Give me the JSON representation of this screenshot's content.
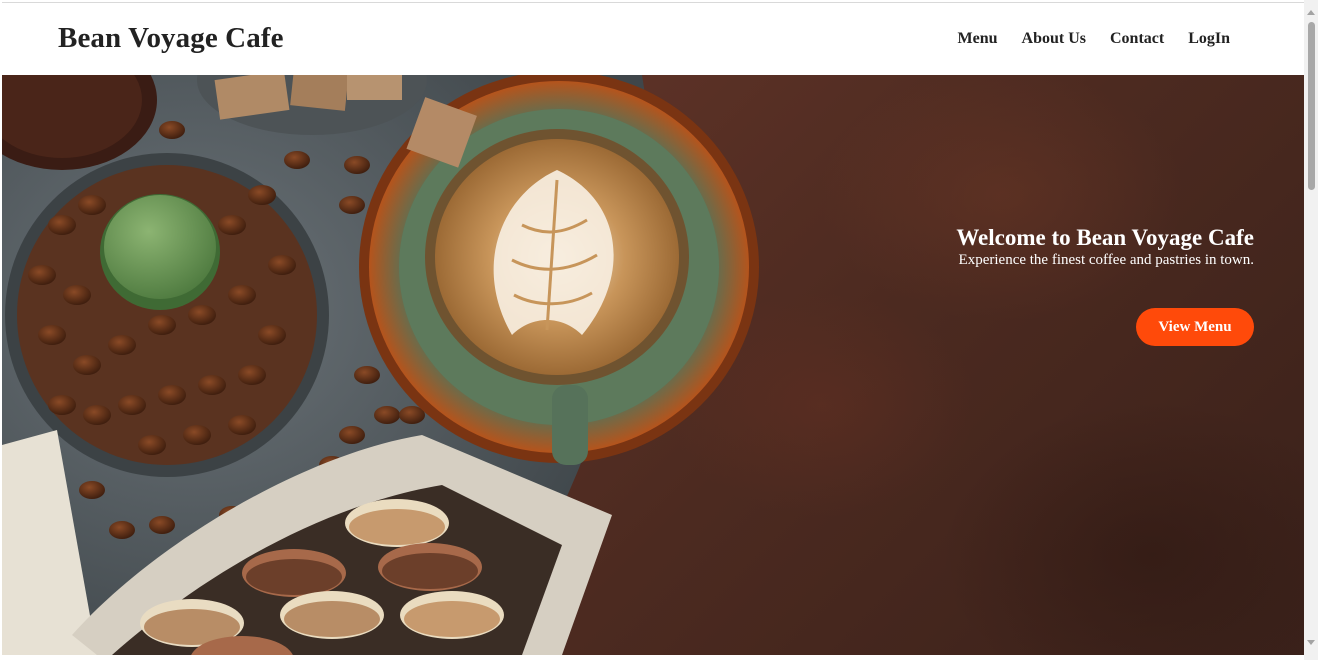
{
  "header": {
    "brand": "Bean Voyage Cafe",
    "nav": [
      {
        "label": "Menu"
      },
      {
        "label": "About Us"
      },
      {
        "label": "Contact"
      },
      {
        "label": "LogIn"
      }
    ]
  },
  "hero": {
    "title": "Welcome to Bean Voyage Cafe",
    "subtitle": "Experience the finest coffee and pastries in town.",
    "cta_label": "View Menu"
  },
  "colors": {
    "accent": "#ff4a0a",
    "background": "#4a2a20",
    "text": "#222222"
  }
}
